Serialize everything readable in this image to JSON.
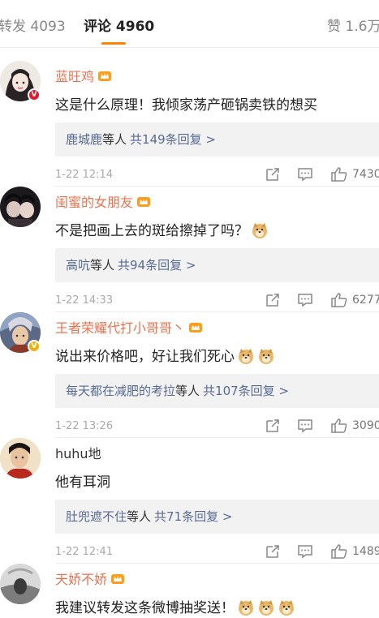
{
  "tabs": {
    "repost": "转发 4093",
    "comment": "评论 4960",
    "like": "赞 1.6万"
  },
  "colors": {
    "accent": "#ff8200",
    "username": "#eb7350",
    "link": "#576b95"
  },
  "comments": [
    {
      "username": "蓝旺鸡",
      "vip_badge": "crown-icon",
      "verified": "red",
      "text": "这是什么原理！我倾家荡产砸锅卖铁的想买",
      "emoji_count": 0,
      "reply_names": "鹿城鹿",
      "reply_mid": "等人",
      "reply_more": "共149条回复 >",
      "time": "1-22 12:14",
      "likes": "7430"
    },
    {
      "username": "闺蜜的女朋友",
      "vip_badge": "crown-icon",
      "verified": "none",
      "text": "不是把画上去的斑给擦掉了吗？",
      "emoji_count": 1,
      "reply_names": "高吭",
      "reply_mid": "等人",
      "reply_more": "共94条回复 >",
      "time": "1-22 14:33",
      "likes": "6277"
    },
    {
      "username": "王者荣耀代打小哥哥丶",
      "vip_badge": "crown-icon",
      "verified": "gold",
      "text": "说出来价格吧，好让我们死心",
      "emoji_count": 2,
      "reply_names": "每天都在减肥的考拉",
      "reply_mid": "等人",
      "reply_more": "共107条回复 >",
      "time": "1-22 13:26",
      "likes": "3090"
    },
    {
      "username": "huhu地",
      "vip_badge": "",
      "verified": "none",
      "text": "他有耳洞",
      "emoji_count": 0,
      "reply_names": "肚兜遮不住",
      "reply_mid": "等人",
      "reply_more": "共71条回复 >",
      "time": "1-22 12:41",
      "likes": "1489"
    },
    {
      "username": "天娇不娇",
      "vip_badge": "crown-icon",
      "verified": "none",
      "text": "我建议转发这条微博抽奖送！",
      "emoji_count": 3
    }
  ]
}
